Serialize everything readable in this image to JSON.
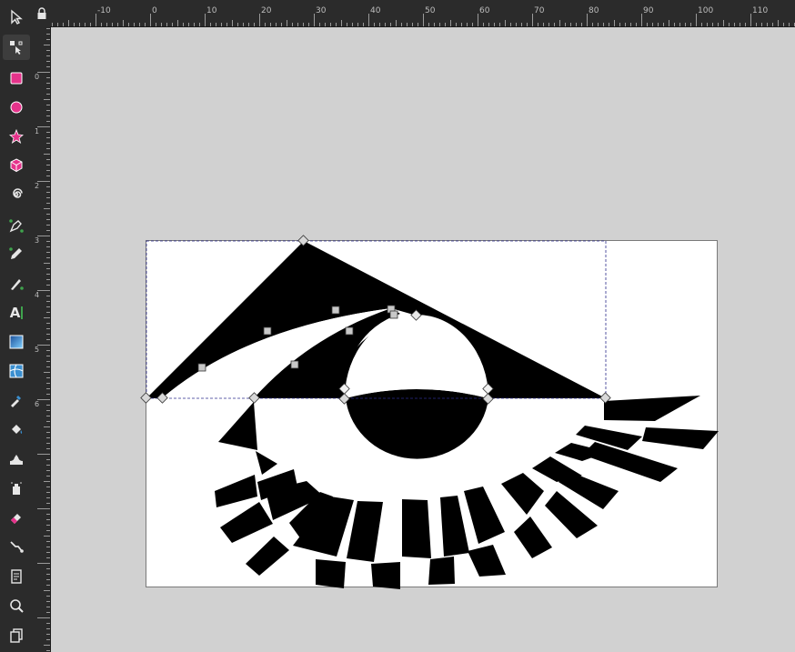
{
  "toolbox": {
    "tools": [
      {
        "name": "selector-tool",
        "icon": "arrow-icon"
      },
      {
        "name": "node-tool",
        "icon": "node-edit-icon",
        "active": true
      },
      {
        "name": "rectangle-tool",
        "icon": "square-icon"
      },
      {
        "name": "ellipse-tool",
        "icon": "circle-icon"
      },
      {
        "name": "star-tool",
        "icon": "star-icon"
      },
      {
        "name": "box3d-tool",
        "icon": "cube-icon"
      },
      {
        "name": "spiral-tool",
        "icon": "spiral-icon"
      },
      {
        "name": "pen-tool",
        "icon": "pen-icon"
      },
      {
        "name": "pencil-tool",
        "icon": "pencil-icon"
      },
      {
        "name": "calligraphy-tool",
        "icon": "calligraphy-icon"
      },
      {
        "name": "text-tool",
        "icon": "text-icon",
        "glyph": "A"
      },
      {
        "name": "gradient-tool",
        "icon": "gradient-icon"
      },
      {
        "name": "mesh-tool",
        "icon": "mesh-icon"
      },
      {
        "name": "dropper-tool",
        "icon": "dropper-icon"
      },
      {
        "name": "paint-bucket-tool",
        "icon": "bucket-icon"
      },
      {
        "name": "tweak-tool",
        "icon": "tweak-icon"
      },
      {
        "name": "spray-tool",
        "icon": "spray-icon"
      },
      {
        "name": "eraser-tool",
        "icon": "eraser-icon"
      },
      {
        "name": "connector-tool",
        "icon": "connector-icon"
      },
      {
        "name": "pages-tool",
        "icon": "pages-icon"
      },
      {
        "name": "zoom-tool",
        "icon": "zoom-icon"
      },
      {
        "name": "measure-tool",
        "icon": "copy-icon"
      }
    ]
  },
  "ruler": {
    "horizontal_labels": [
      "-10",
      "0",
      "10",
      "20",
      "30",
      "40",
      "50",
      "60",
      "70",
      "80",
      "90",
      "100",
      "110"
    ],
    "vertical_labels": [
      "0",
      "1",
      "2",
      "3",
      "4",
      "5",
      "6"
    ],
    "lock_icon": "lock-icon"
  },
  "colors": {
    "accent_pink": "#e5338b",
    "ui_dark": "#2b2b2b",
    "canvas_bg": "#d1d1d1",
    "page": "#ffffff",
    "artwork": "#000000",
    "selection_dash": "#2d2d8c"
  }
}
